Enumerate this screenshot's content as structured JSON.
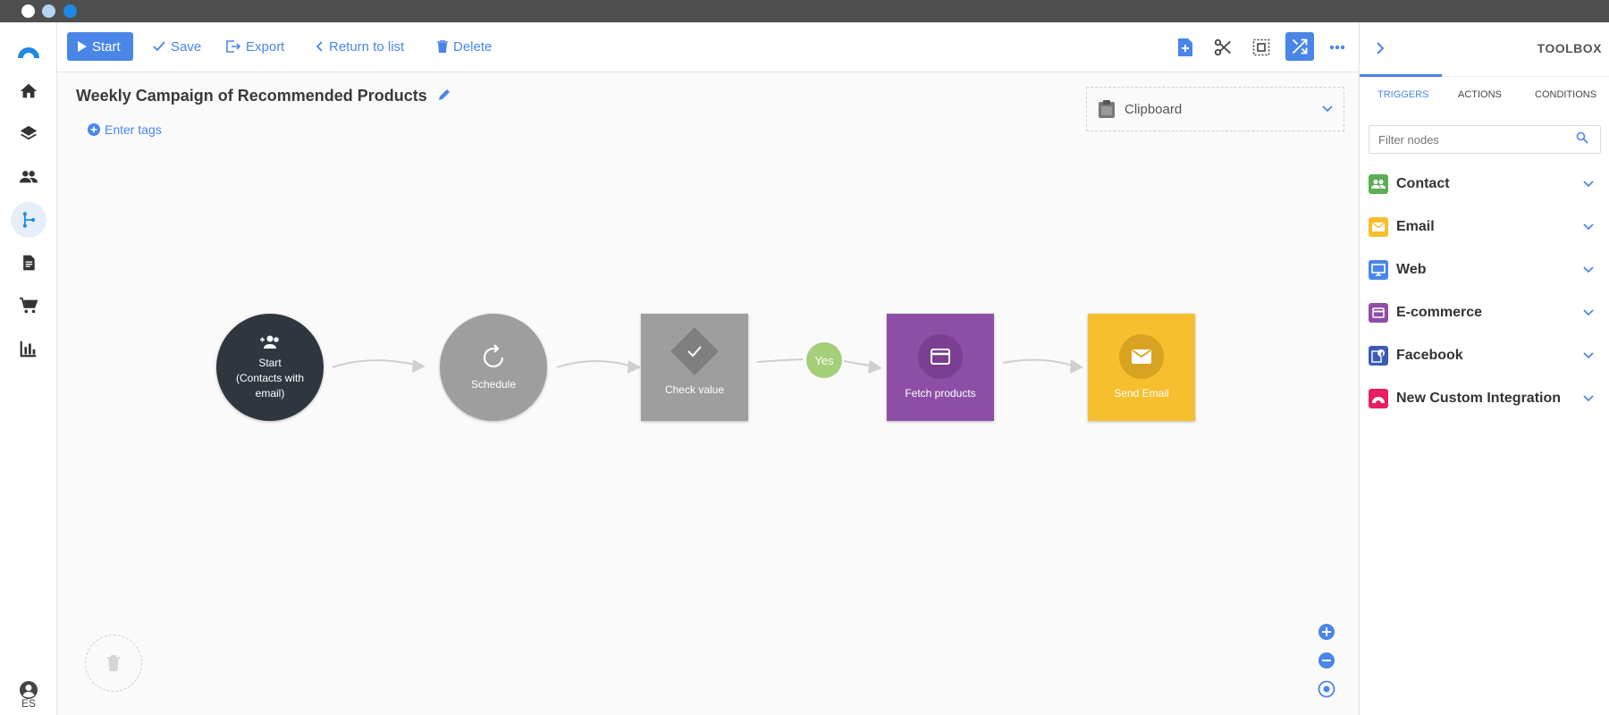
{
  "window": {
    "dots": [
      "#ffffff",
      "#b3d4f0",
      "#1e88e5"
    ]
  },
  "sidebar": {
    "items": [
      "brand-logo",
      "home-icon",
      "layers-icon",
      "contacts-icon",
      "automation-icon",
      "document-icon",
      "cart-icon",
      "reports-icon"
    ],
    "active": "automation-icon",
    "language": "ES"
  },
  "toolbar": {
    "start_label": "Start",
    "save_label": "Save",
    "export_label": "Export",
    "return_label": "Return to list",
    "delete_label": "Delete",
    "icons": [
      "add-node-icon",
      "cut-icon",
      "select-area-icon",
      "shuffle-icon",
      "more-icon"
    ]
  },
  "workflow": {
    "title": "Weekly Campaign of Recommended Products",
    "tags_label": "Enter tags",
    "clipboard_label": "Clipboard",
    "nodes": [
      {
        "label_lines": [
          "Start",
          "(Contacts with",
          "email)"
        ],
        "color": "#2f3640"
      },
      {
        "label": "Schedule",
        "color": "#9e9e9e"
      },
      {
        "label": "Check value",
        "color": "#9e9e9e"
      },
      {
        "label": "Fetch products",
        "color": "#8e4ea6"
      },
      {
        "label": "Send Email",
        "color": "#f7bf2e"
      }
    ],
    "yes_label": "Yes"
  },
  "toolbox": {
    "title": "TOOLBOX",
    "tabs": [
      "TRIGGERS",
      "ACTIONS",
      "CONDITIONS"
    ],
    "active_tab": "TRIGGERS",
    "filter_placeholder": "Filter nodes",
    "categories": [
      {
        "label": "Contact",
        "color": "#5cae55",
        "icon": "contacts-icon"
      },
      {
        "label": "Email",
        "color": "#f7bf2e",
        "icon": "email-icon"
      },
      {
        "label": "Web",
        "color": "#4a86e8",
        "icon": "monitor-icon"
      },
      {
        "label": "E-commerce",
        "color": "#8e4ea6",
        "icon": "card-icon"
      },
      {
        "label": "Facebook",
        "color": "#3b5bb5",
        "icon": "facebook-icon"
      },
      {
        "label": "New Custom Integration",
        "color": "#e91e63",
        "icon": "integration-icon"
      }
    ]
  },
  "accent_color": "#4a86e8"
}
